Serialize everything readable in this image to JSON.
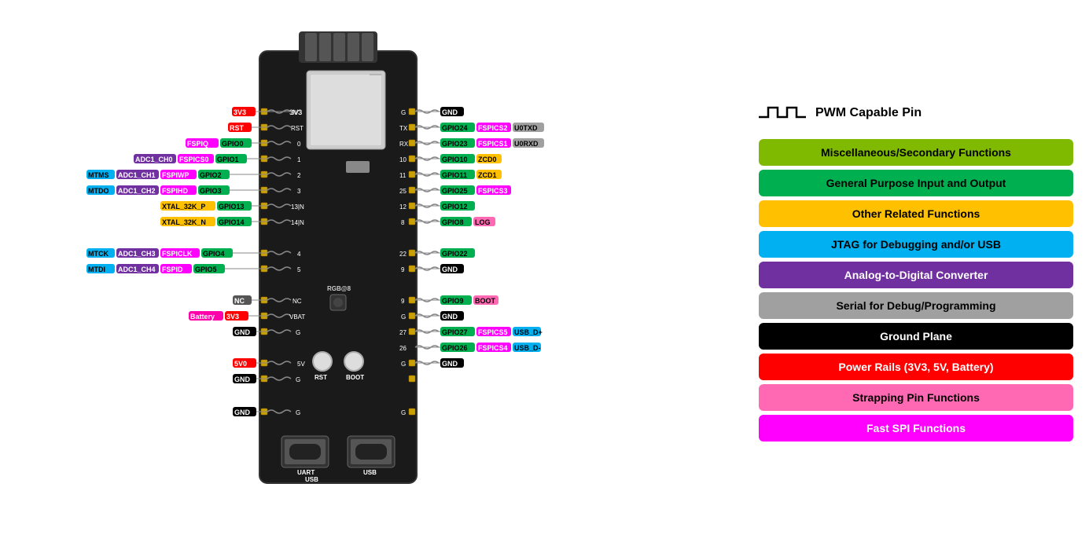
{
  "legend": {
    "pwm_label": "PWM Capable Pin",
    "items": [
      {
        "id": "misc",
        "label": "Miscellaneous/Secondary Functions",
        "bg": "#7FBA00",
        "color": "#000"
      },
      {
        "id": "gpio",
        "label": "General Purpose Input and Output",
        "bg": "#00B050",
        "color": "#000"
      },
      {
        "id": "other",
        "label": "Other Related Functions",
        "bg": "#FFC000",
        "color": "#000"
      },
      {
        "id": "jtag",
        "label": "JTAG for Debugging and/or USB",
        "bg": "#00B0F0",
        "color": "#000"
      },
      {
        "id": "adc",
        "label": "Analog-to-Digital Converter",
        "bg": "#7030A0",
        "color": "#fff"
      },
      {
        "id": "serial",
        "label": "Serial for Debug/Programming",
        "bg": "#A0A0A0",
        "color": "#000"
      },
      {
        "id": "ground",
        "label": "Ground Plane",
        "bg": "#000000",
        "color": "#fff"
      },
      {
        "id": "power",
        "label": "Power Rails (3V3, 5V, Battery)",
        "bg": "#FF0000",
        "color": "#fff"
      },
      {
        "id": "strapping",
        "label": "Strapping Pin Functions",
        "bg": "#FF69B4",
        "color": "#000"
      },
      {
        "id": "fastspi",
        "label": "Fast SPI Functions",
        "bg": "#FF00FF",
        "color": "#fff"
      }
    ]
  }
}
